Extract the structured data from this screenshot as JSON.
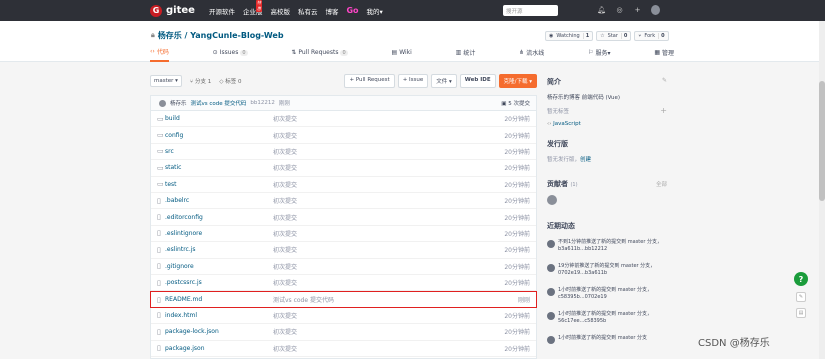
{
  "topnav": {
    "logo_letter": "G",
    "logo_text": "gitee",
    "items": [
      "开源软件",
      "企业版",
      "高校版",
      "私有云",
      "博客",
      "Go",
      "我的▾"
    ],
    "hot_badge": "特惠",
    "search_placeholder": "搜开源",
    "icons": [
      "notification-icon",
      "location-icon",
      "plus-icon",
      "avatar"
    ]
  },
  "repo": {
    "owner": "杨存乐",
    "name": "YangCunle-Blog-Web",
    "title": "杨存乐 / YangCunle-Blog-Web",
    "watch_label": "Watching",
    "watch_count": "1",
    "star_label": "Star",
    "star_count": "0",
    "fork_label": "Fork",
    "fork_count": "0"
  },
  "tabs": [
    {
      "label": "代码",
      "count": ""
    },
    {
      "label": "Issues",
      "count": "0"
    },
    {
      "label": "Pull Requests",
      "count": "0"
    },
    {
      "label": "Wiki",
      "count": ""
    },
    {
      "label": "统计",
      "count": ""
    },
    {
      "label": "流水线",
      "count": ""
    },
    {
      "label": "服务▾",
      "count": ""
    },
    {
      "label": "管理",
      "count": ""
    }
  ],
  "toolbar": {
    "branch": "master ▾",
    "branches": "分支 1",
    "tags": "标签 0",
    "pull_request": "+ Pull Request",
    "issue": "+ Issue",
    "file": "文件 ▾",
    "webide": "Web IDE",
    "clone": "克隆/下载 ▾"
  },
  "commit": {
    "author": "杨存乐",
    "message": "测试vs code 提交代码",
    "hash": "bb12212",
    "time": "刚刚",
    "count": "5 次提交"
  },
  "files": [
    {
      "type": "folder",
      "name": "build",
      "msg": "初次提交",
      "time": "20分钟前"
    },
    {
      "type": "folder",
      "name": "config",
      "msg": "初次提交",
      "time": "20分钟前"
    },
    {
      "type": "folder",
      "name": "src",
      "msg": "初次提交",
      "time": "20分钟前"
    },
    {
      "type": "folder",
      "name": "static",
      "msg": "初次提交",
      "time": "20分钟前"
    },
    {
      "type": "folder",
      "name": "test",
      "msg": "初次提交",
      "time": "20分钟前"
    },
    {
      "type": "file",
      "name": ".babelrc",
      "msg": "初次提交",
      "time": "20分钟前"
    },
    {
      "type": "file",
      "name": ".editorconfig",
      "msg": "初次提交",
      "time": "20分钟前"
    },
    {
      "type": "file",
      "name": ".eslintignore",
      "msg": "初次提交",
      "time": "20分钟前"
    },
    {
      "type": "file",
      "name": ".eslintrc.js",
      "msg": "初次提交",
      "time": "20分钟前"
    },
    {
      "type": "file",
      "name": ".gitignore",
      "msg": "初次提交",
      "time": "20分钟前"
    },
    {
      "type": "file",
      "name": ".postcssrc.js",
      "msg": "初次提交",
      "time": "20分钟前"
    },
    {
      "type": "file",
      "name": "README.md",
      "msg": "测试vs code 提交代码",
      "time": "刚刚",
      "highlight": true
    },
    {
      "type": "file",
      "name": "index.html",
      "msg": "初次提交",
      "time": "20分钟前"
    },
    {
      "type": "file",
      "name": "package-lock.json",
      "msg": "初次提交",
      "time": "20分钟前"
    },
    {
      "type": "file",
      "name": "package.json",
      "msg": "初次提交",
      "time": "20分钟前"
    }
  ],
  "sidebar": {
    "intro_title": "简介",
    "intro_text": "杨存乐的博客 前端代码 (Vue)",
    "no_tags": "暂无标签",
    "language": "JavaScript",
    "release_title": "发行版",
    "release_text": "暂无发行版，",
    "release_link": "创建",
    "contributors_title": "贡献者",
    "contributors_count": "(1)",
    "contributors_all": "全部",
    "activity_title": "近期动态",
    "activities": [
      "不到1分钟前推送了新的提交到 master 分支，b3a611b...bb12212",
      "19分钟前推送了新的提交到 master 分支，0702e19...b3a611b",
      "1小时前推送了新的提交到 master 分支，c58395b...0702e19",
      "1小时前推送了新的提交到 master 分支，56c17ee...c58395b",
      "1小时前推送了新的提交到 master 分支"
    ]
  },
  "watermark": "CSDN @杨存乐"
}
